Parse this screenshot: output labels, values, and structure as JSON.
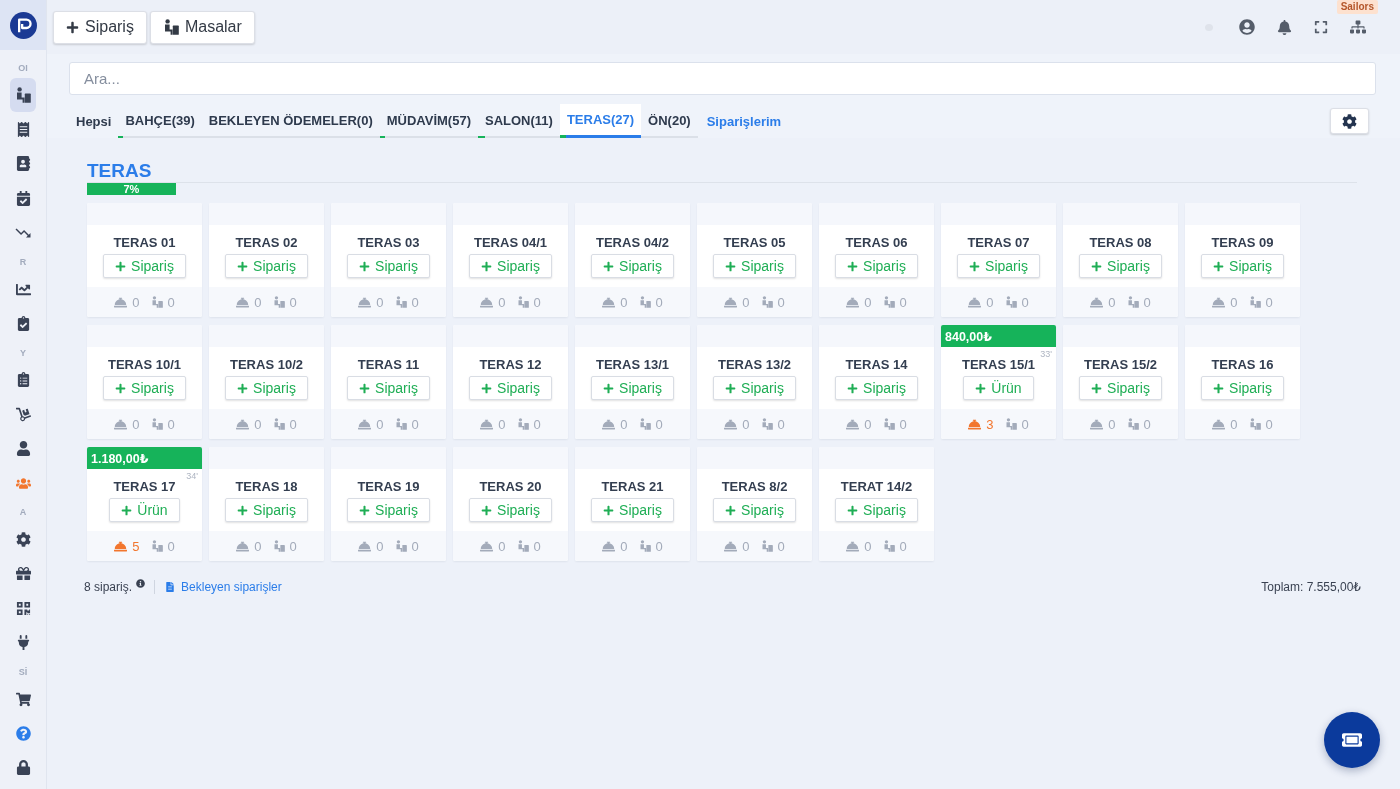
{
  "sidebar": {
    "sections": [
      {
        "label": "OI",
        "items": [
          {
            "selected": true,
            "highlighted": false
          },
          {
            "selected": false,
            "highlighted": false
          },
          {
            "selected": false,
            "highlighted": false
          },
          {
            "selected": false,
            "highlighted": false
          },
          {
            "selected": false,
            "highlighted": false
          }
        ]
      },
      {
        "label": "R",
        "items": [
          {
            "selected": false,
            "highlighted": false
          },
          {
            "selected": false,
            "highlighted": false
          }
        ]
      },
      {
        "label": "Y",
        "items": [
          {
            "selected": false,
            "highlighted": false
          },
          {
            "selected": false,
            "highlighted": false
          },
          {
            "selected": false,
            "highlighted": false
          },
          {
            "selected": false,
            "highlighted": true
          }
        ]
      },
      {
        "label": "A",
        "items": [
          {
            "selected": false,
            "highlighted": false
          },
          {
            "selected": false,
            "highlighted": false
          },
          {
            "selected": false,
            "highlighted": false
          },
          {
            "selected": false,
            "highlighted": false
          }
        ]
      },
      {
        "label": "Sİ",
        "items": [
          {
            "selected": false,
            "highlighted": false
          },
          {
            "selected": false,
            "highlighted": false
          },
          {
            "selected": false,
            "highlighted": false
          }
        ]
      }
    ]
  },
  "toolbar": {
    "buttons": [
      {
        "kind": "add",
        "label": "Sipariş"
      },
      {
        "kind": "tables",
        "label": "Masalar"
      }
    ],
    "account_tag": "Sailors"
  },
  "search": {
    "placeholder": "Ara..."
  },
  "tabs": [
    {
      "kind": "all",
      "label": "Hepsi",
      "selected": false
    },
    {
      "kind": "area",
      "label": "BAHÇE(39)",
      "selected": false,
      "level": 0.06
    },
    {
      "kind": "area",
      "label": "BEKLEYEN ÖDEMELER(0)",
      "selected": false
    },
    {
      "kind": "area",
      "label": "MÜDAVİM(57)",
      "selected": false,
      "level": 0.05
    },
    {
      "kind": "area",
      "label": "SALON(11)",
      "selected": false,
      "level": 0.09
    },
    {
      "kind": "area",
      "label": "TERAS(27)",
      "selected": true,
      "level": 0.07
    },
    {
      "kind": "area",
      "label": "ÖN(20)",
      "selected": false
    }
  ],
  "orders_link": "Siparişlerim",
  "section": {
    "title": "TERAS",
    "level": 0.07,
    "reading": "7%"
  },
  "tables": [
    {
      "name": "TERAS 01",
      "occupied": false,
      "action": "Sipariş",
      "orders": "0",
      "guests": "0"
    },
    {
      "name": "TERAS 02",
      "occupied": false,
      "action": "Sipariş",
      "orders": "0",
      "guests": "0"
    },
    {
      "name": "TERAS 03",
      "occupied": false,
      "action": "Sipariş",
      "orders": "0",
      "guests": "0"
    },
    {
      "name": "TERAS 04/1",
      "occupied": false,
      "action": "Sipariş",
      "orders": "0",
      "guests": "0"
    },
    {
      "name": "TERAS 04/2",
      "occupied": false,
      "action": "Sipariş",
      "orders": "0",
      "guests": "0"
    },
    {
      "name": "TERAS 05",
      "occupied": false,
      "action": "Sipariş",
      "orders": "0",
      "guests": "0"
    },
    {
      "name": "TERAS 06",
      "occupied": false,
      "action": "Sipariş",
      "orders": "0",
      "guests": "0"
    },
    {
      "name": "TERAS 07",
      "occupied": false,
      "action": "Sipariş",
      "orders": "0",
      "guests": "0"
    },
    {
      "name": "TERAS 08",
      "occupied": false,
      "action": "Sipariş",
      "orders": "0",
      "guests": "0"
    },
    {
      "name": "TERAS 09",
      "occupied": false,
      "action": "Sipariş",
      "orders": "0",
      "guests": "0"
    },
    {
      "name": "TERAS 10/1",
      "occupied": false,
      "action": "Sipariş",
      "orders": "0",
      "guests": "0"
    },
    {
      "name": "TERAS 10/2",
      "occupied": false,
      "action": "Sipariş",
      "orders": "0",
      "guests": "0"
    },
    {
      "name": "TERAS 11",
      "occupied": false,
      "action": "Sipariş",
      "orders": "0",
      "guests": "0"
    },
    {
      "name": "TERAS 12",
      "occupied": false,
      "action": "Sipariş",
      "orders": "0",
      "guests": "0"
    },
    {
      "name": "TERAS 13/1",
      "occupied": false,
      "action": "Sipariş",
      "orders": "0",
      "guests": "0"
    },
    {
      "name": "TERAS 13/2",
      "occupied": false,
      "action": "Sipariş",
      "orders": "0",
      "guests": "0"
    },
    {
      "name": "TERAS 14",
      "occupied": false,
      "action": "Sipariş",
      "orders": "0",
      "guests": "0"
    },
    {
      "name": "TERAS 15/1",
      "occupied": true,
      "amount": "840,00₺",
      "elapsed": "33'",
      "action": "Ürün",
      "orders": "3",
      "guests": "0"
    },
    {
      "name": "TERAS 15/2",
      "occupied": false,
      "action": "Sipariş",
      "orders": "0",
      "guests": "0"
    },
    {
      "name": "TERAS 16",
      "occupied": false,
      "action": "Sipariş",
      "orders": "0",
      "guests": "0"
    },
    {
      "name": "TERAS 17",
      "occupied": true,
      "amount": "1.180,00₺",
      "elapsed": "34'",
      "action": "Ürün",
      "orders": "5",
      "guests": "0"
    },
    {
      "name": "TERAS 18",
      "occupied": false,
      "action": "Sipariş",
      "orders": "0",
      "guests": "0"
    },
    {
      "name": "TERAS 19",
      "occupied": false,
      "action": "Sipariş",
      "orders": "0",
      "guests": "0"
    },
    {
      "name": "TERAS 20",
      "occupied": false,
      "action": "Sipariş",
      "orders": "0",
      "guests": "0"
    },
    {
      "name": "TERAS 21",
      "occupied": false,
      "action": "Sipariş",
      "orders": "0",
      "guests": "0"
    },
    {
      "name": "TERAS 8/2",
      "occupied": false,
      "action": "Sipariş",
      "orders": "0",
      "guests": "0"
    },
    {
      "name": "TERAT 14/2",
      "occupied": false,
      "action": "Sipariş",
      "orders": "0",
      "guests": "0"
    }
  ],
  "footer": {
    "order_count": "8 sipariş.",
    "pending_link": "Bekleyen siparişler",
    "total": "Toplam: 7.555,00₺"
  }
}
